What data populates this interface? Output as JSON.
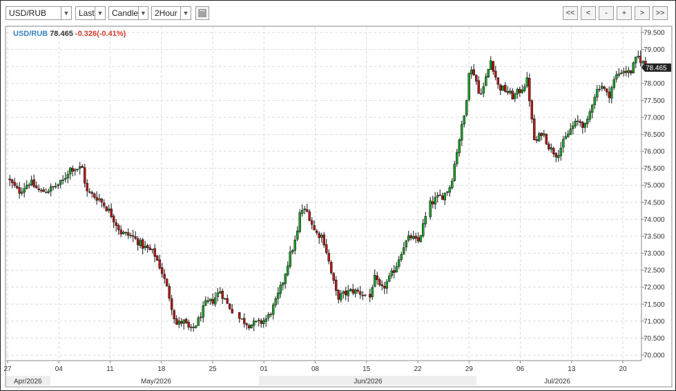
{
  "toolbar": {
    "symbol": "USD/RUB",
    "price_type": "Last",
    "chart_style": "Candle",
    "interval": "2Hour",
    "list_icon": "list-icon",
    "nav_buttons": [
      "<<",
      "<",
      "-",
      "+",
      ">",
      ">>"
    ]
  },
  "legend": {
    "symbol": "USD/RUB",
    "last": "78.465",
    "change": "-0.326(-0.41%)"
  },
  "colors": {
    "up": "#1f9e2c",
    "down": "#b31b1b",
    "wick": "#111111",
    "accent": "#3d85c6",
    "change": "#d63d2e",
    "last_badge": "#222222"
  },
  "chart_data": {
    "type": "candlestick",
    "symbol": "USD/RUB",
    "title": "",
    "xlabel": "",
    "ylabel": "",
    "ylim": [
      69.8,
      79.75
    ],
    "y_ticks": [
      "79.500",
      "79.000",
      "78.500",
      "78.000",
      "77.500",
      "77.000",
      "76.500",
      "76.000",
      "75.500",
      "75.000",
      "74.500",
      "74.000",
      "73.500",
      "73.000",
      "72.500",
      "72.000",
      "71.500",
      "71.000",
      "70.500",
      "70.000"
    ],
    "y_tick_values": [
      79.5,
      79,
      78.5,
      78,
      77.5,
      77,
      76.5,
      76,
      75.5,
      75,
      74.5,
      74,
      73.5,
      73,
      72.5,
      72,
      71.5,
      71,
      70.5,
      70
    ],
    "x_ticks": [
      "27",
      "04",
      "11",
      "18",
      "25",
      "01",
      "08",
      "15",
      "22",
      "29",
      "06",
      "13",
      "20"
    ],
    "x_tick_days": [
      0,
      7,
      14,
      21,
      28,
      35,
      42,
      49,
      56,
      63,
      70,
      77,
      84
    ],
    "x_range_days": [
      0,
      87.3
    ],
    "months": [
      "Apr/2026",
      "May/2026",
      "Jun/2026",
      "Jul/2026"
    ],
    "last_value": "78.465",
    "grid": true,
    "price_path": [
      [
        0.0,
        75.2
      ],
      [
        1.5,
        74.8
      ],
      [
        3.0,
        75.1
      ],
      [
        4.5,
        74.8
      ],
      [
        6.0,
        74.9
      ],
      [
        7.5,
        75.1
      ],
      [
        8.5,
        75.5
      ],
      [
        10.2,
        75.5
      ],
      [
        10.8,
        74.8
      ],
      [
        12.5,
        74.6
      ],
      [
        14.0,
        74.2
      ],
      [
        15.5,
        73.6
      ],
      [
        17.0,
        73.5
      ],
      [
        18.5,
        73.2
      ],
      [
        20.0,
        73.0
      ],
      [
        21.0,
        72.5
      ],
      [
        22.0,
        71.8
      ],
      [
        23.0,
        70.9
      ],
      [
        24.0,
        71.0
      ],
      [
        25.0,
        70.7
      ],
      [
        26.0,
        71.0
      ],
      [
        27.0,
        71.5
      ],
      [
        28.0,
        71.6
      ],
      [
        29.0,
        71.9
      ],
      [
        30.0,
        71.5
      ],
      [
        31.5,
        71.1
      ],
      [
        33.0,
        70.9
      ],
      [
        34.5,
        70.95
      ],
      [
        35.5,
        71.1
      ],
      [
        36.5,
        71.5
      ],
      [
        37.5,
        72.1
      ],
      [
        38.5,
        72.9
      ],
      [
        39.5,
        73.5
      ],
      [
        40.0,
        74.3
      ],
      [
        41.0,
        74.2
      ],
      [
        42.0,
        73.6
      ],
      [
        43.0,
        73.5
      ],
      [
        43.6,
        73.0
      ],
      [
        44.2,
        72.4
      ],
      [
        45.0,
        71.7
      ],
      [
        46.0,
        71.8
      ],
      [
        47.0,
        71.9
      ],
      [
        48.0,
        71.85
      ],
      [
        49.5,
        71.7
      ],
      [
        50.0,
        72.3
      ],
      [
        51.0,
        71.9
      ],
      [
        52.0,
        72.2
      ],
      [
        53.0,
        72.6
      ],
      [
        54.0,
        73.2
      ],
      [
        55.0,
        73.5
      ],
      [
        56.0,
        73.3
      ],
      [
        57.0,
        74.0
      ],
      [
        57.5,
        74.4
      ],
      [
        58.5,
        74.6
      ],
      [
        59.5,
        74.7
      ],
      [
        60.5,
        75.0
      ],
      [
        61.5,
        76.2
      ],
      [
        62.5,
        77.2
      ],
      [
        63.0,
        78.4
      ],
      [
        63.8,
        78.3
      ],
      [
        64.3,
        77.7
      ],
      [
        65.0,
        77.9
      ],
      [
        66.0,
        78.7
      ],
      [
        67.0,
        77.9
      ],
      [
        68.0,
        77.8
      ],
      [
        69.0,
        77.6
      ],
      [
        70.0,
        77.8
      ],
      [
        71.0,
        78.1
      ],
      [
        71.5,
        77.0
      ],
      [
        72.0,
        76.2
      ],
      [
        73.0,
        76.6
      ],
      [
        74.0,
        76.1
      ],
      [
        75.0,
        75.9
      ],
      [
        76.0,
        76.3
      ],
      [
        77.0,
        76.7
      ],
      [
        78.0,
        76.9
      ],
      [
        79.0,
        76.7
      ],
      [
        80.0,
        77.6
      ],
      [
        81.0,
        78.0
      ],
      [
        82.0,
        77.6
      ],
      [
        83.0,
        78.2
      ],
      [
        84.0,
        78.4
      ],
      [
        85.0,
        78.3
      ],
      [
        86.0,
        78.8
      ],
      [
        87.3,
        78.465
      ]
    ]
  }
}
